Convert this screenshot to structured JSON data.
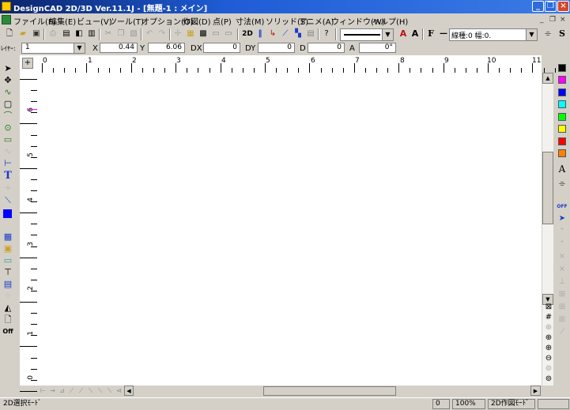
{
  "window": {
    "title": "DesignCAD 2D/3D Ver.11.1J - [無題-1 : メイン]",
    "controls": [
      "_",
      "❐",
      "×"
    ]
  },
  "menubar": {
    "items": [
      "ファイル(F)",
      "編集(E)",
      "ビュー(V)",
      "ツール(T)",
      "オプション(O)",
      "作図(D)",
      "点(P)",
      "寸法(M)",
      "ソリッド(S)",
      "アニメ(A)",
      "ウィンドウ(W)",
      "ヘルプ(H)"
    ],
    "mdi_controls": [
      "_",
      "❐",
      "×"
    ]
  },
  "toolbar": {
    "text_button": "2D",
    "font_a1": "A",
    "font_a2": "A",
    "font_f": "F",
    "line_type_label": "線種:0 幅:0.",
    "s_button": "S"
  },
  "coords": {
    "layer_label": "ﾚｲﾔｰ:",
    "layer_value": "1",
    "x_label": "X",
    "x_value": "0.44",
    "y_label": "Y",
    "y_value": "6.06",
    "dx_label": "DX",
    "dx_value": "0",
    "dy_label": "DY",
    "dy_value": "0",
    "d_label": "D",
    "d_value": "0",
    "a_label": "A",
    "a_value": "0°"
  },
  "ruler": {
    "top_labels": [
      "0",
      "1",
      "2",
      "3",
      "4",
      "5",
      "6",
      "7",
      "8",
      "9",
      "10",
      "11"
    ],
    "left_labels": [
      "6",
      "5",
      "4",
      "3",
      "2",
      "1",
      "0"
    ]
  },
  "palette": {
    "colors": [
      "#000000",
      "#ff00ff",
      "#0000ff",
      "#00ffff",
      "#00ff00",
      "#ffff00",
      "#ff0000",
      "#ff8000"
    ],
    "text_a": "A",
    "off_label": "OFF"
  },
  "left_tools": {
    "text_tool": "T",
    "off_label": "Off"
  },
  "status": {
    "mode": "2D選択ﾓｰﾄﾞ",
    "value": "0",
    "zoom": "100%",
    "draw_mode": "2D作図ﾓｰﾄﾞ"
  }
}
